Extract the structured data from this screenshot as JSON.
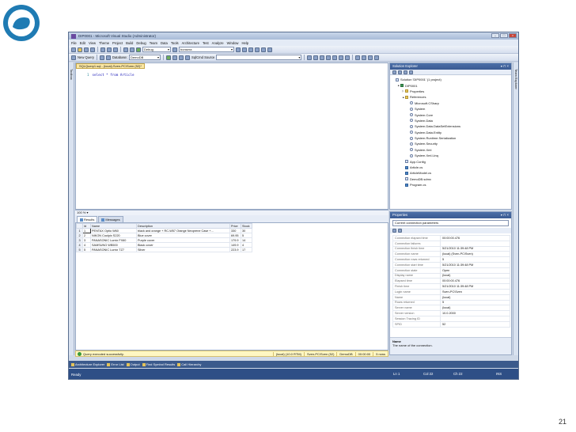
{
  "slide_number": "21",
  "window": {
    "title": "DIP0001 - Microsoft Visual Studio (Administrator)",
    "menu": [
      "File",
      "Edit",
      "View",
      "Theme",
      "Project",
      "Build",
      "Debug",
      "Team",
      "Data",
      "Tools",
      "Architecture",
      "Test",
      "Analyze",
      "Window",
      "Help"
    ],
    "toolbar": {
      "config": "Debug",
      "platform": "bonsera",
      "new_query": "New Query",
      "database_label": "Database:",
      "database": "DemoDB",
      "sqlcmd": "SqlCmd Source"
    }
  },
  "side_strips": {
    "left": "Toolbox",
    "right": "Team Explorer"
  },
  "editor": {
    "tab": "SQLQuery1.sql - (local).Sven-PC\\Sven (52)*",
    "line_number": "1",
    "code": "select * from Article",
    "zoom": "100 %"
  },
  "results": {
    "tabs": [
      "Results",
      "Messages"
    ],
    "columns": [
      "Id",
      "Name",
      "Description",
      "Price",
      "Stock"
    ],
    "rows": [
      {
        "n": "1",
        "id": "1",
        "name": "PENTAX  Optio W60",
        "desc": "black and orange + RC-W57 Orange Neoprene Case +...",
        "price": "330",
        "stock": "30"
      },
      {
        "n": "2",
        "id": "2",
        "name": "NIKON  Coolpix S220",
        "desc": "Blue cover",
        "price": "69.95",
        "stock": "5"
      },
      {
        "n": "3",
        "id": "3",
        "name": "PANASONIC  Lumix FX60",
        "desc": "Purple cover",
        "price": "179.9",
        "stock": "14"
      },
      {
        "n": "4",
        "id": "4",
        "name": "SAMSUNG  WB500",
        "desc": "Black cover",
        "price": "149.9",
        "stock": "4"
      },
      {
        "n": "5",
        "id": "5",
        "name": "PANASONIC  Lumix TZ7",
        "desc": "Silver",
        "price": "223.9",
        "stock": "17"
      }
    ],
    "status": "Query executed successfully.",
    "status_segments": [
      "(local) (10.0 RTM)",
      "Sven-PC\\Sven (52)",
      "DemoDB",
      "00:00:00",
      "5 rows"
    ]
  },
  "solution_explorer": {
    "title": "Solution Explorer",
    "items": [
      {
        "label": "Solution 'DIP0001' (1 project)",
        "icon": "solution",
        "indent": 0,
        "arrow": ""
      },
      {
        "label": "DIP0001",
        "icon": "proj",
        "indent": 1,
        "arrow": "▲"
      },
      {
        "label": "Properties",
        "icon": "folder",
        "indent": 2,
        "arrow": "▷"
      },
      {
        "label": "References",
        "icon": "folder",
        "indent": 2,
        "arrow": "▲"
      },
      {
        "label": "Microsoft.CSharp",
        "icon": "ref",
        "indent": 3,
        "arrow": ""
      },
      {
        "label": "System",
        "icon": "ref",
        "indent": 3,
        "arrow": ""
      },
      {
        "label": "System.Core",
        "icon": "ref",
        "indent": 3,
        "arrow": ""
      },
      {
        "label": "System.Data",
        "icon": "ref",
        "indent": 3,
        "arrow": ""
      },
      {
        "label": "System.Data.DataSetExtensions",
        "icon": "ref",
        "indent": 3,
        "arrow": ""
      },
      {
        "label": "System.Data.Entity",
        "icon": "ref",
        "indent": 3,
        "arrow": ""
      },
      {
        "label": "System.Runtime.Serialization",
        "icon": "ref",
        "indent": 3,
        "arrow": ""
      },
      {
        "label": "System.Security",
        "icon": "ref",
        "indent": 3,
        "arrow": ""
      },
      {
        "label": "System.Xml",
        "icon": "ref",
        "indent": 3,
        "arrow": ""
      },
      {
        "label": "System.Xml.Linq",
        "icon": "ref",
        "indent": 3,
        "arrow": ""
      },
      {
        "label": "App.Config",
        "icon": "file",
        "indent": 2,
        "arrow": ""
      },
      {
        "label": "Article.cs",
        "icon": "cs",
        "indent": 2,
        "arrow": ""
      },
      {
        "label": "ArticleModel.cs",
        "icon": "cs",
        "indent": 2,
        "arrow": ""
      },
      {
        "label": "DemoDB.sdmx",
        "icon": "file",
        "indent": 2,
        "arrow": ""
      },
      {
        "label": "Program.cs",
        "icon": "cs",
        "indent": 2,
        "arrow": ""
      }
    ]
  },
  "properties": {
    "title": "Properties",
    "object": "Current connection parameters",
    "rows": [
      {
        "name": "Connection elapsed time",
        "value": "00:00:00.476"
      },
      {
        "name": "Connection failures",
        "value": ""
      },
      {
        "name": "Connection finish time",
        "value": "5/21/2010 11:39:48 PM"
      },
      {
        "name": "Connection name",
        "value": "(local) (Sven-PC\\Sven)"
      },
      {
        "name": "Connection rows returned",
        "value": "5"
      },
      {
        "name": "Connection start time",
        "value": "5/21/2010 11:39:48 PM"
      },
      {
        "name": "Connection state",
        "value": "Open"
      },
      {
        "name": "Display name",
        "value": "(local)"
      },
      {
        "name": "Elapsed time",
        "value": "00:00:00.476"
      },
      {
        "name": "Finish time",
        "value": "5/21/2010 11:39:48 PM"
      },
      {
        "name": "Login name",
        "value": "Sven-PC\\Sven"
      },
      {
        "name": "Name",
        "value": "(local)"
      },
      {
        "name": "Rows returned",
        "value": "5"
      },
      {
        "name": "Server name",
        "value": "(local)"
      },
      {
        "name": "Server version",
        "value": "10.0.2000"
      },
      {
        "name": "Session Tracing ID",
        "value": ""
      },
      {
        "name": "SPID",
        "value": "52"
      }
    ],
    "desc_title": "Name",
    "desc_text": "The name of the connection."
  },
  "bottom_tabs": [
    "Architecture Explorer",
    "Error List",
    "Output",
    "Find Symbol Results",
    "Call Hierarchy"
  ],
  "status_bar": {
    "left": "Ready",
    "ln": "Ln 1",
    "col": "Col 22",
    "ch": "Ch 22",
    "ins": "INS"
  }
}
